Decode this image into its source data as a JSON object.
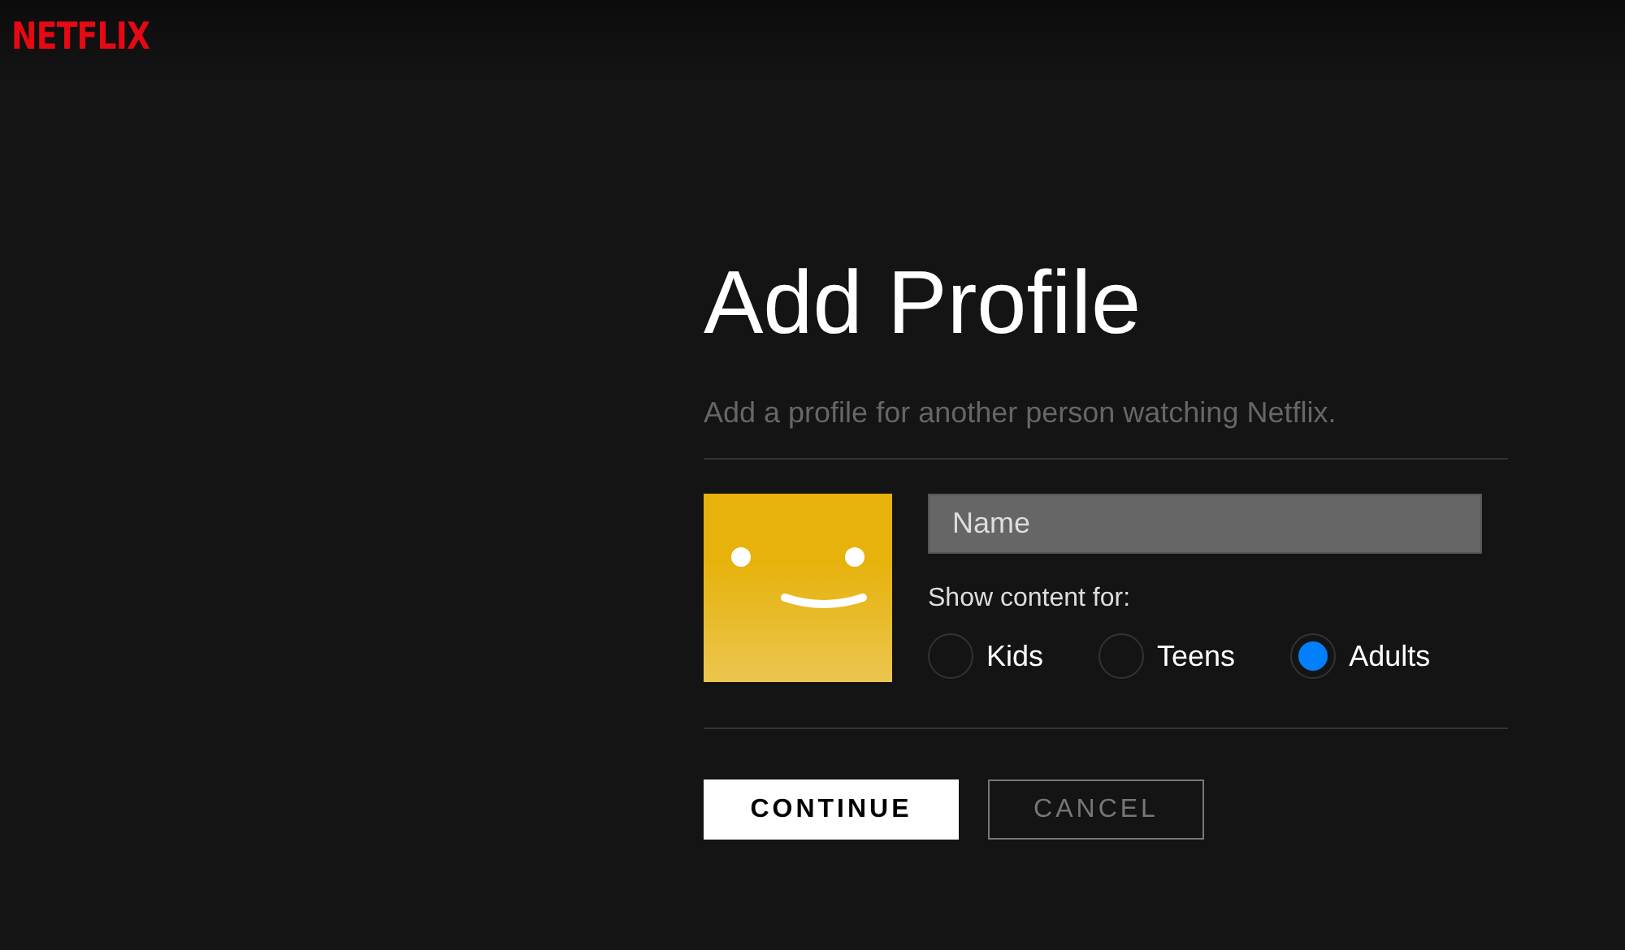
{
  "header": {
    "logo": "NETFLIX"
  },
  "title": "Add Profile",
  "subtitle": "Add a profile for another person watching Netflix.",
  "name_field": {
    "placeholder": "Name"
  },
  "content_label": "Show content for:",
  "options": [
    {
      "label": "Kids",
      "selected": false
    },
    {
      "label": "Teens",
      "selected": false
    },
    {
      "label": "Adults",
      "selected": true
    }
  ],
  "buttons": [
    {
      "label": "CONTINUE",
      "kind": "primary"
    },
    {
      "label": "CANCEL",
      "kind": "secondary"
    }
  ]
}
